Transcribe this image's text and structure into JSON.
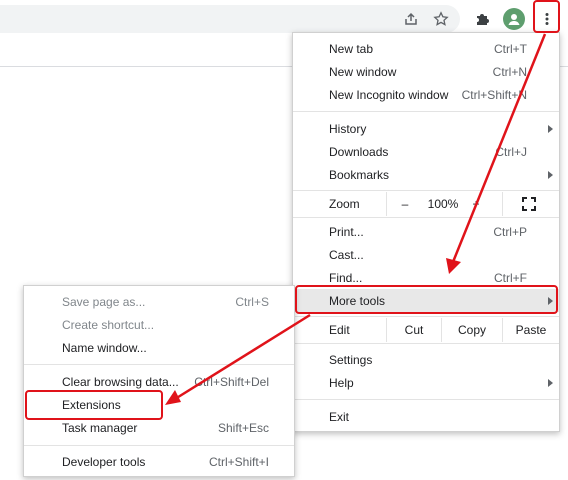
{
  "main_menu": {
    "items_group1": [
      {
        "label": "New tab",
        "shortcut": "Ctrl+T"
      },
      {
        "label": "New window",
        "shortcut": "Ctrl+N"
      },
      {
        "label": "New Incognito window",
        "shortcut": "Ctrl+Shift+N"
      }
    ],
    "history": "History",
    "downloads": {
      "label": "Downloads",
      "shortcut": "Ctrl+J"
    },
    "bookmarks": "Bookmarks",
    "zoom": {
      "label": "Zoom",
      "minus": "–",
      "value": "100%",
      "plus": "+"
    },
    "print": {
      "label": "Print...",
      "shortcut": "Ctrl+P"
    },
    "cast": "Cast...",
    "find": {
      "label": "Find...",
      "shortcut": "Ctrl+F"
    },
    "more_tools": "More tools",
    "edit": {
      "label": "Edit",
      "cut": "Cut",
      "copy": "Copy",
      "paste": "Paste"
    },
    "settings": "Settings",
    "help": "Help",
    "exit": "Exit"
  },
  "more_tools_menu": {
    "save_page": {
      "label": "Save page as...",
      "shortcut": "Ctrl+S"
    },
    "create_shortcut": "Create shortcut...",
    "name_window": "Name window...",
    "clear_browsing": {
      "label": "Clear browsing data...",
      "shortcut": "Ctrl+Shift+Del"
    },
    "extensions": "Extensions",
    "task_manager": {
      "label": "Task manager",
      "shortcut": "Shift+Esc"
    },
    "developer_tools": {
      "label": "Developer tools",
      "shortcut": "Ctrl+Shift+I"
    }
  },
  "icons": [
    "share-icon",
    "star-icon",
    "puzzle-icon",
    "profile-avatar-icon",
    "kebab-menu-icon"
  ],
  "colors": {
    "annotation": "#e0131a",
    "avatar": "#5e9e6e"
  }
}
